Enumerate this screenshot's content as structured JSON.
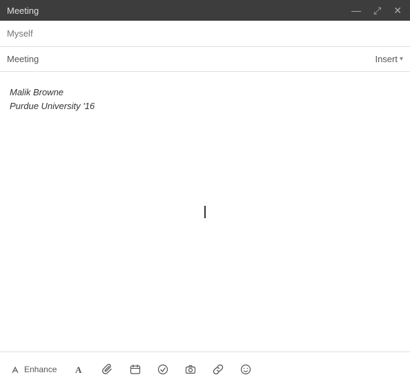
{
  "titlebar": {
    "title": "Meeting",
    "minimize_label": "—",
    "expand_label": "⤢",
    "close_label": "✕"
  },
  "to_field": {
    "placeholder": "Myself",
    "value": ""
  },
  "subject_row": {
    "subject": "Meeting",
    "insert_label": "Insert",
    "chevron": "▾"
  },
  "body": {
    "line1": "Malik Browne",
    "line2": "Purdue University '16"
  },
  "toolbar": {
    "enhance_label": "Enhance",
    "icons": [
      {
        "name": "text-format-icon",
        "symbol": "A"
      },
      {
        "name": "attachment-icon",
        "symbol": "📎"
      },
      {
        "name": "calendar-icon",
        "symbol": "📅"
      },
      {
        "name": "check-icon",
        "symbol": "✓"
      },
      {
        "name": "camera-icon",
        "symbol": "📷"
      },
      {
        "name": "link-icon",
        "symbol": "🔗"
      },
      {
        "name": "emoji-icon",
        "symbol": "🙂"
      }
    ]
  }
}
